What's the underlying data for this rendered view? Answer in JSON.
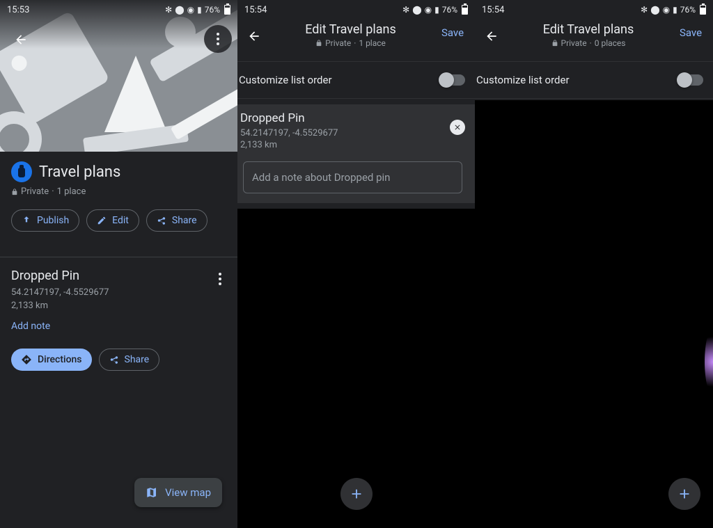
{
  "status": {
    "time1": "15:53",
    "time2": "15:54",
    "time3": "15:54",
    "battery": "76%"
  },
  "pane1": {
    "title": "Travel plans",
    "privacy": "Private",
    "count": "1 place",
    "chips": {
      "publish": "Publish",
      "edit": "Edit",
      "share": "Share"
    },
    "place": {
      "name": "Dropped Pin",
      "coords": "54.2147197, -4.5529677",
      "distance": "2,133 km",
      "add_note": "Add note",
      "directions": "Directions",
      "share": "Share"
    },
    "view_map": "View map"
  },
  "pane2": {
    "title": "Edit Travel plans",
    "privacy": "Private",
    "count": "1 place",
    "save": "Save",
    "customize": "Customize list order",
    "place": {
      "name": "Dropped Pin",
      "coords": "54.2147197, -4.5529677",
      "distance": "2,133 km",
      "note_placeholder": "Add a note about Dropped pin"
    }
  },
  "pane3": {
    "title": "Edit Travel plans",
    "privacy": "Private",
    "count": "0 places",
    "save": "Save",
    "customize": "Customize list order"
  }
}
